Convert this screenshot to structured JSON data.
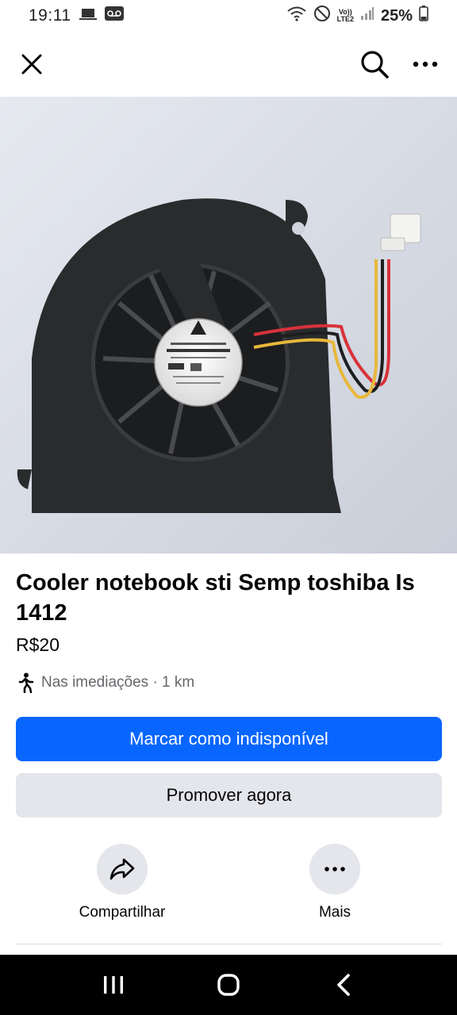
{
  "status_bar": {
    "time": "19:11",
    "lte_top": "Vo))",
    "lte_bottom": "LTE2",
    "battery": "25%"
  },
  "app_bar": {
    "close_icon": "close-icon",
    "search_icon": "search-icon",
    "more_icon": "more-horizontal-icon"
  },
  "listing": {
    "image_desc": "laptop cooling fan",
    "title": "Cooler notebook sti Semp toshiba Is 1412",
    "price": "R$20",
    "location": "Nas imediações · 1 km"
  },
  "buttons": {
    "primary": "Marcar como indisponível",
    "secondary": "Promover agora"
  },
  "actions": {
    "share": "Compartilhar",
    "more": "Mais"
  },
  "colors": {
    "primary_blue": "#0866ff",
    "secondary_gray": "#e4e6eb",
    "muted_text": "#65676b"
  }
}
